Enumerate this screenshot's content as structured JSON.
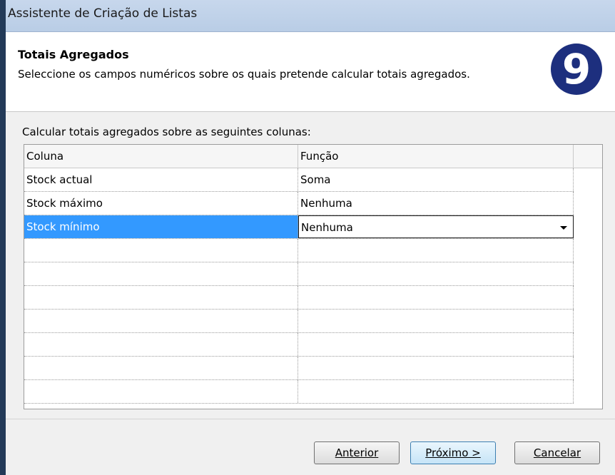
{
  "window": {
    "title": "Assistente de Criação de Listas"
  },
  "header": {
    "title": "Totais Agregados",
    "description": "Seleccione os campos numéricos sobre os quais pretende calcular totais agregados.",
    "logo_glyph": "9"
  },
  "grid": {
    "label": "Calcular totais agregados sobre as seguintes colunas:",
    "columns": [
      "Coluna",
      "Função"
    ],
    "rows": [
      {
        "coluna": "Stock actual",
        "funcao": "Soma"
      },
      {
        "coluna": "Stock máximo",
        "funcao": "Nenhuma"
      },
      {
        "coluna": "Stock mínimo",
        "funcao": "Nenhuma"
      }
    ]
  },
  "buttons": {
    "previous": "Anterior",
    "next": "Próximo >",
    "cancel": "Cancelar"
  },
  "colors": {
    "selection": "#3399ff",
    "logo_bg": "#1d2f7e",
    "window_frame": "#233a58"
  }
}
